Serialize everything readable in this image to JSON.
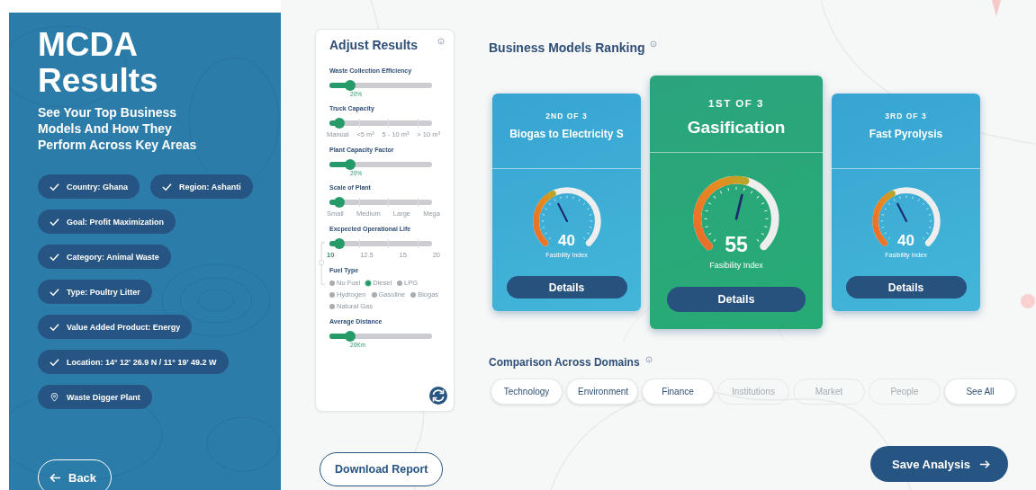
{
  "sidebar": {
    "title": "MCDA Results",
    "subtitle": "See Your Top Business Models And How They Perform Across Key Areas",
    "filters": [
      {
        "kind": "check",
        "label": "Country: Ghana"
      },
      {
        "kind": "check",
        "label": "Region: Ashanti"
      },
      {
        "kind": "check",
        "label": "Goal: Profit Maximization"
      },
      {
        "kind": "check",
        "label": "Category: Animal Waste"
      },
      {
        "kind": "check",
        "label": "Type: Poultry Litter"
      },
      {
        "kind": "check",
        "label": "Value Added Product: Energy"
      },
      {
        "kind": "check",
        "label": "Location: 14° 12' 26.9 N  / 11° 19' 49.2 W"
      },
      {
        "kind": "pin",
        "label": "Waste Digger Plant"
      }
    ],
    "back_button": "Back"
  },
  "adjust": {
    "title": "Adjust Results",
    "controls": [
      {
        "kind": "slider",
        "label": "Waste Collection Efficiency",
        "level": 0.2,
        "reading": "20%"
      },
      {
        "kind": "ticks",
        "label": "Truck Capacity",
        "level": 0.1,
        "ticks": [
          {
            "label": "Manual",
            "selected": false
          },
          {
            "label": "<5 m³",
            "selected": false
          },
          {
            "label": "5 - 10 m³",
            "selected": false
          },
          {
            "label": "> 10 m³",
            "selected": false
          }
        ]
      },
      {
        "kind": "slider",
        "label": "Plant Capacity Factor",
        "level": 0.2,
        "reading": "20%"
      },
      {
        "kind": "ticks",
        "label": "Scale of Plant",
        "level": 0.1,
        "ticks": [
          {
            "label": "Small",
            "selected": false
          },
          {
            "label": "Medium",
            "selected": false
          },
          {
            "label": "Large",
            "selected": false
          },
          {
            "label": "Mega",
            "selected": false
          }
        ]
      },
      {
        "kind": "ticks",
        "label": "Excpected Operational Life",
        "level": 0.1,
        "ticks": [
          {
            "label": "10",
            "selected": true
          },
          {
            "label": "12.5",
            "selected": false
          },
          {
            "label": "15",
            "selected": false
          },
          {
            "label": "20",
            "selected": false
          }
        ]
      },
      {
        "kind": "radios",
        "label": "Fuel Type",
        "options": [
          {
            "label": "No Fuel",
            "selected": false
          },
          {
            "label": "Diesel",
            "selected": true
          },
          {
            "label": "LPG",
            "selected": false
          },
          {
            "label": "Hydrogen",
            "selected": false
          },
          {
            "label": "Gasoline",
            "selected": false
          },
          {
            "label": "Biogas",
            "selected": false
          },
          {
            "label": "Natural Gas",
            "selected": false
          }
        ]
      },
      {
        "kind": "slider",
        "label": "Average Distance",
        "level": 0.2,
        "reading": "20Km"
      }
    ]
  },
  "download_button": "Download Report",
  "ranking": {
    "title": "Business Models Ranking",
    "cards": [
      {
        "rank": "2ND OF 3",
        "name": "Biogas to Electricity S",
        "score": "40",
        "caption": "Fasibility Index",
        "button": "Details",
        "selected": false
      },
      {
        "rank": "1ST OF 3",
        "name": "Gasification",
        "score": "55",
        "caption": "Fasibility Index",
        "button": "Details",
        "selected": true
      },
      {
        "rank": "3RD OF 3",
        "name": "Fast Pyrolysis",
        "score": "40",
        "caption": "Fasibility Index",
        "button": "Details",
        "selected": false
      }
    ]
  },
  "domains": {
    "title": "Comparison Across Domains",
    "chips": [
      {
        "label": "Technology",
        "disabled": false
      },
      {
        "label": "Environment",
        "disabled": false
      },
      {
        "label": "Finance",
        "disabled": false
      },
      {
        "label": "Institutions",
        "disabled": true
      },
      {
        "label": "Market",
        "disabled": true
      },
      {
        "label": "People",
        "disabled": true
      },
      {
        "label": "See All",
        "disabled": false
      }
    ]
  },
  "save_button": "Save Analysis"
}
